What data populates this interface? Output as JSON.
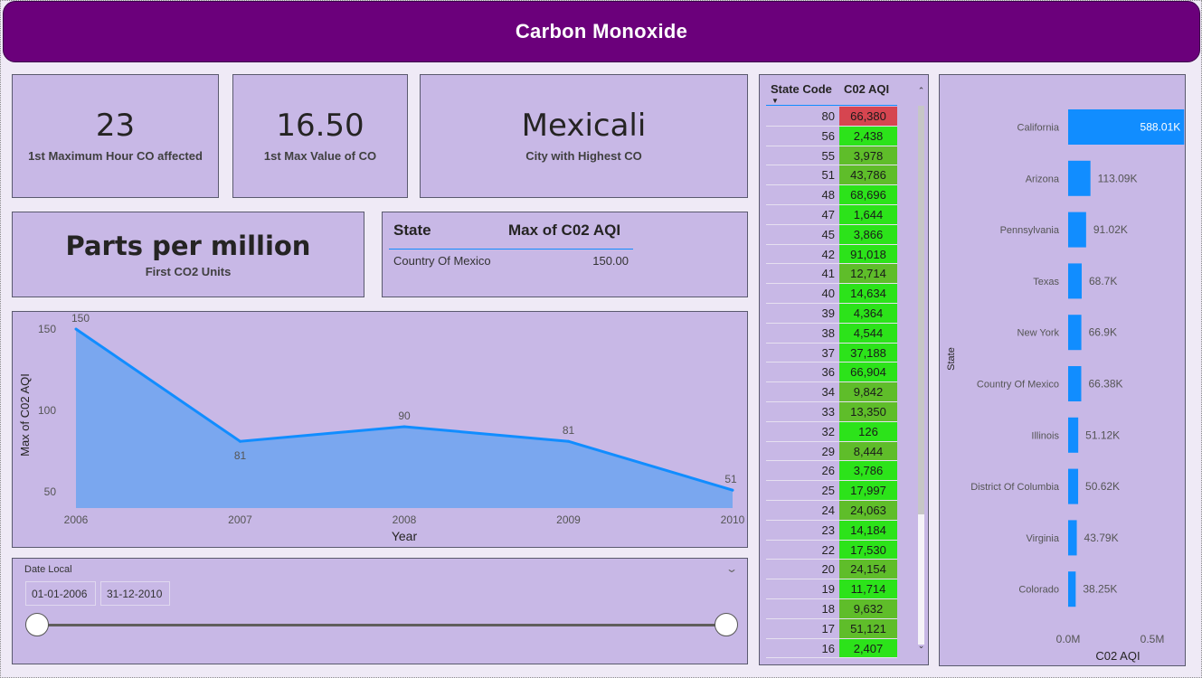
{
  "header": {
    "title": "Carbon Monoxide"
  },
  "cards": [
    {
      "value": "23",
      "label": "1st Maximum Hour CO affected"
    },
    {
      "value": "16.50",
      "label": "1st Max Value of CO"
    },
    {
      "value": "Mexicali",
      "label": "City with Highest CO"
    },
    {
      "value": "Parts per million",
      "label": "First CO2 Units"
    }
  ],
  "state_table": {
    "col1": "State",
    "col2": "Max of C02 AQI",
    "rows": [
      {
        "state": "Country Of Mexico",
        "value": "150.00"
      }
    ]
  },
  "chart_data": [
    {
      "type": "area",
      "x": [
        2006,
        2007,
        2008,
        2009,
        2010
      ],
      "y": [
        150,
        81,
        90,
        81,
        51
      ],
      "data_labels": [
        "150",
        "81",
        "90",
        "81",
        "51"
      ],
      "xlabel": "Year",
      "ylabel": "Max of C02 AQI",
      "x_ticks": [
        "2006",
        "2007",
        "2008",
        "2009",
        "2010"
      ],
      "y_ticks": [
        "50",
        "100",
        "150"
      ],
      "ylim": [
        40,
        155
      ],
      "colors": {
        "line": "#118dff",
        "fill": "#7aa7ef"
      }
    },
    {
      "type": "bar",
      "orientation": "horizontal",
      "categories": [
        "California",
        "Arizona",
        "Pennsylvania",
        "Texas",
        "New York",
        "Country Of Mexico",
        "Illinois",
        "District Of Columbia",
        "Virginia",
        "Colorado"
      ],
      "values": [
        588010,
        113090,
        91020,
        68700,
        66900,
        66380,
        51120,
        50620,
        43790,
        38250
      ],
      "data_labels": [
        "588.01K",
        "113.09K",
        "91.02K",
        "68.7K",
        "66.9K",
        "66.38K",
        "51.12K",
        "50.62K",
        "43.79K",
        "38.25K"
      ],
      "xlabel": "C02 AQI",
      "ylabel": "State",
      "x_ticks": [
        "0.0M",
        "0.5M"
      ],
      "xlim": [
        0,
        1000000
      ],
      "colors": {
        "bar": "#118dff"
      }
    }
  ],
  "slicer": {
    "title": "Date Local",
    "start": "01-01-2006",
    "end": "31-12-2010",
    "range_fraction": [
      0,
      1
    ]
  },
  "state_code_table": {
    "col1": "State Code",
    "col2": "C02 AQI",
    "colors": {
      "high": "#d64550",
      "good": "#2ce31a",
      "mid": "#5fbd2a"
    },
    "rows": [
      {
        "code": "80",
        "aqi": "66,380",
        "level": "high"
      },
      {
        "code": "56",
        "aqi": "2,438",
        "level": "good"
      },
      {
        "code": "55",
        "aqi": "3,978",
        "level": "mid"
      },
      {
        "code": "51",
        "aqi": "43,786",
        "level": "mid"
      },
      {
        "code": "48",
        "aqi": "68,696",
        "level": "good"
      },
      {
        "code": "47",
        "aqi": "1,644",
        "level": "good"
      },
      {
        "code": "45",
        "aqi": "3,866",
        "level": "good"
      },
      {
        "code": "42",
        "aqi": "91,018",
        "level": "good"
      },
      {
        "code": "41",
        "aqi": "12,714",
        "level": "mid"
      },
      {
        "code": "40",
        "aqi": "14,634",
        "level": "good"
      },
      {
        "code": "39",
        "aqi": "4,364",
        "level": "good"
      },
      {
        "code": "38",
        "aqi": "4,544",
        "level": "good"
      },
      {
        "code": "37",
        "aqi": "37,188",
        "level": "good"
      },
      {
        "code": "36",
        "aqi": "66,904",
        "level": "good"
      },
      {
        "code": "34",
        "aqi": "9,842",
        "level": "mid"
      },
      {
        "code": "33",
        "aqi": "13,350",
        "level": "mid"
      },
      {
        "code": "32",
        "aqi": "126",
        "level": "good"
      },
      {
        "code": "29",
        "aqi": "8,444",
        "level": "mid"
      },
      {
        "code": "26",
        "aqi": "3,786",
        "level": "good"
      },
      {
        "code": "25",
        "aqi": "17,997",
        "level": "good"
      },
      {
        "code": "24",
        "aqi": "24,063",
        "level": "mid"
      },
      {
        "code": "23",
        "aqi": "14,184",
        "level": "good"
      },
      {
        "code": "22",
        "aqi": "17,530",
        "level": "good"
      },
      {
        "code": "20",
        "aqi": "24,154",
        "level": "mid"
      },
      {
        "code": "19",
        "aqi": "11,714",
        "level": "good"
      },
      {
        "code": "18",
        "aqi": "9,632",
        "level": "mid"
      },
      {
        "code": "17",
        "aqi": "51,121",
        "level": "mid"
      },
      {
        "code": "16",
        "aqi": "2,407",
        "level": "good"
      }
    ]
  },
  "icons": {
    "sort": "sort-down-icon",
    "chevron": "chevron-down-icon",
    "scroll_up": "scroll-up-icon",
    "scroll_down": "scroll-down-icon"
  }
}
